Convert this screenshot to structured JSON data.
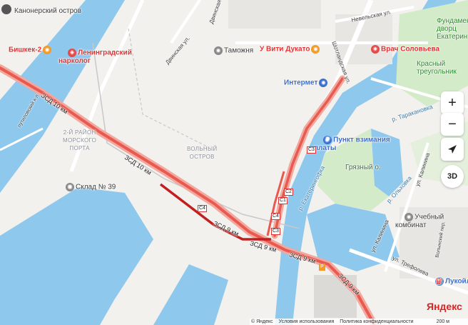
{
  "map": {
    "places": {
      "kanonersky": "Канонерский остров",
      "bishkek": "Бишкек-2",
      "narkolog": "Ленинградский\nнарколог",
      "putilovsky": "путиловский к-л",
      "dvinskaya1": "Двинская ул.",
      "dvinskaya2": "Двинская ул.",
      "tamozhnya": "Таможня",
      "vitiducato": "У Вити Дукато",
      "nevelskaya": "Невельская ул.",
      "vrach": "Врач Соловьева",
      "fund": "Фундамен\nдворц\nЕкатерин",
      "krasny": "Красный\nтреугольник",
      "intermet": "Интермет",
      "shotlandskaya": "Шотландская ул.",
      "tarakanovka": "р. Таракановка",
      "port": "2-Й РАЙОН\nМОРСКОГО\nПОРТА",
      "volny": "ВОЛЬНЫЙ\nОСТРОВ",
      "punkt": "Пункт взимания\nплаты",
      "gryazny": "Грязный о.",
      "olkhovka": "р. Ольховка",
      "ekaterinovka": "р. Екатерингофка",
      "sklad": "Склад № 39",
      "uchebny": "Учебный\nкомбинат",
      "kalinina1": "ул. Калинина",
      "kalinina2": "ул. Калинина",
      "trefoleva": "ул. Трефолева",
      "lukoil": "Лукойл",
      "volynsky": "Волынский пер."
    },
    "road_labels": {
      "zsd10a": "ЗСД 10 км",
      "zsd10b": "ЗСД 10 км",
      "zsd9a": "ЗСД 9 км",
      "zsd9b": "ЗСД 9 км",
      "zsd9c": "ЗСД 9 км",
      "zsd9d": "ЗСД 9 км"
    },
    "shields": {
      "c1": "C1",
      "c2": "C2",
      "c3a": "C3",
      "c3b": "C3",
      "c4a": "C4",
      "c4b": "C4"
    },
    "controls": {
      "zoom_in": "+",
      "zoom_out": "−",
      "view3d": "3D"
    },
    "footer": {
      "copyright": "© Яндекс",
      "terms": "Условия использования",
      "privacy": "Политика конфиденциальности",
      "scale": "200 м"
    },
    "brand": "Яндекс",
    "colors": {
      "water": "#8ec8ec",
      "park": "#d3ebc8",
      "traffic": "#e85a50",
      "traffic_dark": "#c21f1f"
    }
  }
}
